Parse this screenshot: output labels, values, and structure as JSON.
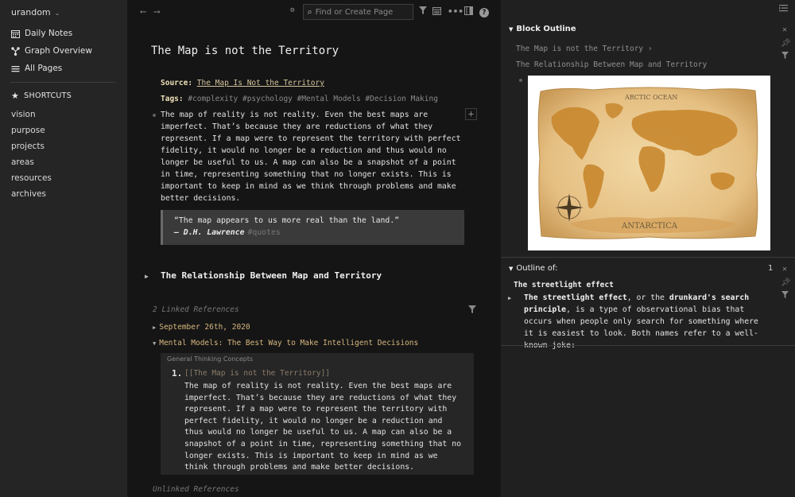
{
  "sidebar": {
    "workspace": "urandom",
    "nav": {
      "daily": "Daily Notes",
      "graph": "Graph Overview",
      "all": "All Pages"
    },
    "shortcuts_heading": "SHORTCUTS",
    "shortcuts": [
      "vision",
      "purpose",
      "projects",
      "areas",
      "resources",
      "archives"
    ]
  },
  "topbar": {
    "search_placeholder": "Find or Create Page"
  },
  "page": {
    "title": "The Map is not the Territory",
    "source_label": "Source:",
    "source_value": "The Map Is Not the Territory",
    "tags_label": "Tags:",
    "tags": "#complexity #psychology #Mental Models #Decision Making",
    "paragraph": "The map of reality is not reality. Even the best maps are imperfect. That’s because they are reductions of what they represent. If a map were to represent the territory with perfect fidelity, it would no longer be a reduction and thus would no longer be useful to us. A map can also be a snapshot of a point in time, representing something that no longer exists. This is important to keep in mind as we think through problems and make better decisions.",
    "quote_text": "“The map appears to us more real than the land.”",
    "quote_author": "— D.H. Lawrence",
    "quote_tag": "#quotes",
    "section_heading": "The Relationship Between Map and Territory"
  },
  "references": {
    "linked_heading": "2 Linked References",
    "ref1": "September 26th, 2020",
    "ref2": "Mental Models: The Best Way to Make Intelligent Decisions",
    "box_breadcrumb": "General Thinking Concepts",
    "box_number": "1.",
    "box_link": "[[The Map is not the Territory]]",
    "box_text": "The map of reality is not reality. Even the best maps are imperfect. That’s because they are reductions of what they represent. If a map were to represent the territory with perfect fidelity, it would no longer be a reduction and thus would no longer be useful to us. A map can also be a snapshot of a point in time, representing something that no longer exists. This is important to keep in mind as we think through problems and make better decisions.",
    "unlinked_heading": "Unlinked References"
  },
  "right": {
    "block_outline_title": "Block Outline",
    "crumb1": "The Map is not the Territory",
    "crumb2": "The Relationship Between Map and Territory",
    "map_label_top": "ARCTIC OCEAN",
    "map_label_bottom": "ANTARCTICA",
    "outline_title": "Outline of:",
    "outline_count": "1",
    "outline_page": "The streetlight effect",
    "outline_b1": "The streetlight effect",
    "outline_t1": ", or the ",
    "outline_b2": "drunkard's search principle",
    "outline_t2": ", is a type of observational bias that occurs when people only search for something where it is easiest to look. Both names refer to a well-known joke:"
  },
  "colors": {
    "sidebar_bg": "#252526",
    "main_bg": "#151515",
    "right_bg": "#202020",
    "accent_gold": "#d7b77f",
    "map_parchment": "#e9c891",
    "map_land": "#c8872d"
  }
}
